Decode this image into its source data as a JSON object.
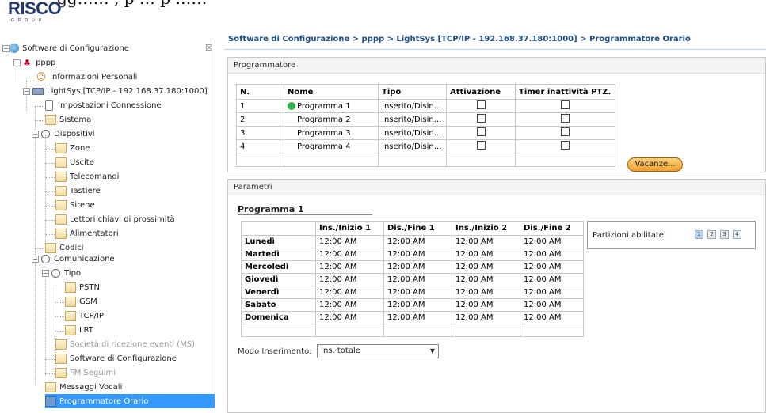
{
  "caption": {
    "text": "gg…… , p   … p                                                                ……"
  },
  "logo": {
    "text": "RISCO",
    "sub": "GROUP"
  },
  "sidebar": {
    "close_glyph": "☒",
    "items": [
      {
        "label": "Software di Configurazione",
        "icon": "globe-icon"
      },
      {
        "label": "pppp",
        "icon": "users-icon"
      },
      {
        "label": "Informazioni Personali",
        "icon": "person-icon"
      },
      {
        "label": "LightSys [TCP/IP - 192.168.37.180:1000]",
        "icon": "panel-device-icon"
      },
      {
        "label": "Impostazioni Connessione",
        "icon": "connection-icon"
      },
      {
        "label": "Sistema",
        "icon": "folder-icon"
      },
      {
        "label": "Dispositivi",
        "icon": "gear-icon"
      },
      {
        "label": "Zone",
        "icon": "folder-icon"
      },
      {
        "label": "Uscite",
        "icon": "folder-icon"
      },
      {
        "label": "Telecomandi",
        "icon": "folder-icon"
      },
      {
        "label": "Tastiere",
        "icon": "folder-icon"
      },
      {
        "label": "Sirene",
        "icon": "folder-icon"
      },
      {
        "label": "Lettori chiavi di prossimità",
        "icon": "folder-icon"
      },
      {
        "label": "Alimentatori",
        "icon": "folder-icon"
      },
      {
        "label": "Codici",
        "icon": "folder-icon"
      },
      {
        "label": "Comunicazione",
        "icon": "gear-icon"
      },
      {
        "label": "Tipo",
        "icon": "gear-icon"
      },
      {
        "label": "PSTN",
        "icon": "folder-icon"
      },
      {
        "label": "GSM",
        "icon": "folder-icon"
      },
      {
        "label": "TCP/IP",
        "icon": "folder-icon"
      },
      {
        "label": "LRT",
        "icon": "folder-icon"
      },
      {
        "label": "Società di ricezione eventi (MS)",
        "icon": "folder-icon"
      },
      {
        "label": "Software di Configurazione",
        "icon": "folder-icon"
      },
      {
        "label": "FM Seguimi",
        "icon": "folder-icon"
      },
      {
        "label": "Messaggi Vocali",
        "icon": "folder-icon"
      },
      {
        "label": "Programmatore Orario",
        "icon": "scheduler-icon"
      }
    ]
  },
  "main": {
    "breadcrumb": "Software di Configurazione > pppp > LightSys [TCP/IP - 192.168.37.180:1000] > Programmatore Orario",
    "programmatore": {
      "header": "Programmatore",
      "columns": [
        "N.",
        "Nome",
        "Tipo",
        "Attivazione",
        "Timer inattività PTZ."
      ],
      "rows": [
        {
          "n": "1",
          "nome": "Programma 1",
          "tipo": "Inserito/Disin...",
          "attivazione": false,
          "timer": false
        },
        {
          "n": "2",
          "nome": "Programma 2",
          "tipo": "Inserito/Disin...",
          "attivazione": false,
          "timer": false
        },
        {
          "n": "3",
          "nome": "Programma 3",
          "tipo": "Inserito/Disin...",
          "attivazione": false,
          "timer": false
        },
        {
          "n": "4",
          "nome": "Programma 4",
          "tipo": "Inserito/Disin...",
          "attivazione": false,
          "timer": false
        }
      ],
      "vacanze_label": "Vacanze..."
    },
    "parametri": {
      "header": "Parametri",
      "program_title": "Programma 1",
      "columns": [
        "",
        "Ins./Inizio 1",
        "Dis./Fine 1",
        "Ins./Inizio 2",
        "Dis./Fine 2"
      ],
      "days": [
        {
          "day": "Lunedì",
          "t": [
            "12:00 AM",
            "12:00 AM",
            "12:00 AM",
            "12:00 AM"
          ]
        },
        {
          "day": "Martedì",
          "t": [
            "12:00 AM",
            "12:00 AM",
            "12:00 AM",
            "12:00 AM"
          ]
        },
        {
          "day": "Mercoledì",
          "t": [
            "12:00 AM",
            "12:00 AM",
            "12:00 AM",
            "12:00 AM"
          ]
        },
        {
          "day": "Giovedì",
          "t": [
            "12:00 AM",
            "12:00 AM",
            "12:00 AM",
            "12:00 AM"
          ]
        },
        {
          "day": "Venerdì",
          "t": [
            "12:00 AM",
            "12:00 AM",
            "12:00 AM",
            "12:00 AM"
          ]
        },
        {
          "day": "Sabato",
          "t": [
            "12:00 AM",
            "12:00 AM",
            "12:00 AM",
            "12:00 AM"
          ]
        },
        {
          "day": "Domenica",
          "t": [
            "12:00 AM",
            "12:00 AM",
            "12:00 AM",
            "12:00 AM"
          ]
        }
      ],
      "partizioni_label": "Partizioni abilitate:",
      "partizioni": [
        "1",
        "2",
        "3",
        "4"
      ],
      "modo_label": "Modo Inserimento:",
      "modo_value": "Ins. totale"
    }
  }
}
